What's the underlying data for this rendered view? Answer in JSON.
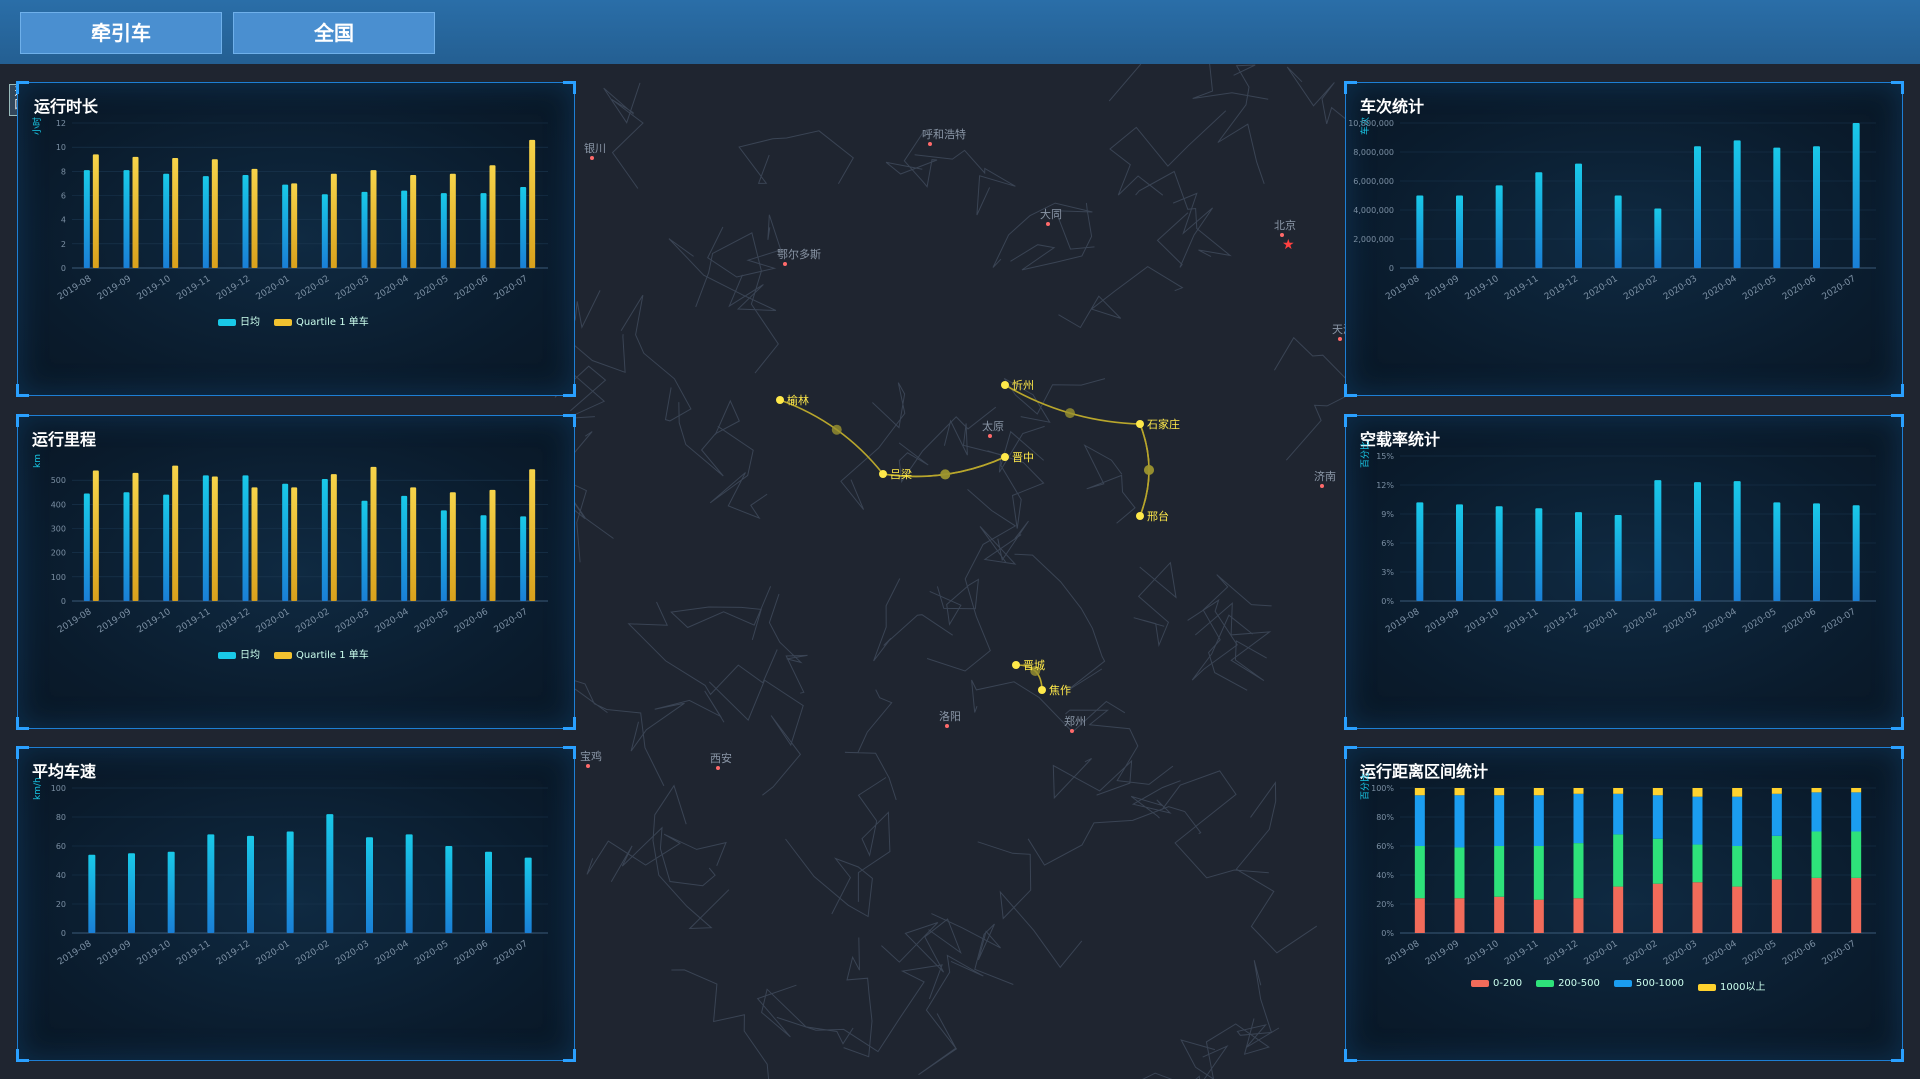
{
  "topbar": {
    "btn_vehicle": "牵引车",
    "btn_region": "全国"
  },
  "back_label": "返回",
  "map": {
    "cities": [
      {
        "name": "榆林",
        "x": 780,
        "y": 400
      },
      {
        "name": "吕梁",
        "x": 883,
        "y": 474
      },
      {
        "name": "晋中",
        "x": 1005,
        "y": 457
      },
      {
        "name": "忻州",
        "x": 1005,
        "y": 385
      },
      {
        "name": "石家庄",
        "x": 1140,
        "y": 424
      },
      {
        "name": "邢台",
        "x": 1140,
        "y": 516
      },
      {
        "name": "晋城",
        "x": 1016,
        "y": 665
      },
      {
        "name": "焦作",
        "x": 1042,
        "y": 690
      }
    ],
    "routes": [
      [
        "榆林",
        "吕梁"
      ],
      [
        "吕梁",
        "晋中"
      ],
      [
        "晋中",
        "吕梁"
      ],
      [
        "忻州",
        "石家庄"
      ],
      [
        "石家庄",
        "邢台"
      ],
      [
        "邢台",
        "石家庄"
      ],
      [
        "晋城",
        "焦作"
      ]
    ],
    "labels": [
      {
        "t": "北京",
        "x": 1282,
        "y": 229
      },
      {
        "t": "太原",
        "x": 990,
        "y": 430
      },
      {
        "t": "西安",
        "x": 718,
        "y": 762
      },
      {
        "t": "郑州",
        "x": 1072,
        "y": 725
      },
      {
        "t": "呼和浩特",
        "x": 930,
        "y": 138
      },
      {
        "t": "鄂尔多斯",
        "x": 785,
        "y": 258
      },
      {
        "t": "银川",
        "x": 592,
        "y": 152
      },
      {
        "t": "大同",
        "x": 1048,
        "y": 218
      },
      {
        "t": "天津",
        "x": 1340,
        "y": 333
      },
      {
        "t": "济南",
        "x": 1322,
        "y": 480
      },
      {
        "t": "洛阳",
        "x": 947,
        "y": 720
      },
      {
        "t": "宝鸡",
        "x": 588,
        "y": 760
      }
    ]
  },
  "colors": {
    "teal": "#19c9e8",
    "blue": "#1a7fd6",
    "yellow": "#f2c230",
    "red": "#f26b5a",
    "green": "#2ee27a",
    "cyan_blue": "#1b9df0",
    "gold": "#ffd22e"
  },
  "panels": {
    "run_time": {
      "title": "运行时长",
      "yunit": "小时",
      "legend": [
        "日均",
        "Quartile 1 单车"
      ]
    },
    "run_mileage": {
      "title": "运行里程",
      "yunit": "km",
      "legend": [
        "日均",
        "Quartile 1 单车"
      ]
    },
    "avg_speed": {
      "title": "平均车速",
      "yunit": "km/h"
    },
    "trip_count": {
      "title": "车次统计",
      "yunit": "车次"
    },
    "empty_rate": {
      "title": "空载率统计",
      "yunit": "百分比"
    },
    "distance_range": {
      "title": "运行距离区间统计",
      "yunit": "百分比",
      "legend": [
        "0-200",
        "200-500",
        "500-1000",
        "1000以上"
      ]
    }
  },
  "chart_data": [
    {
      "id": "run_time",
      "type": "bar",
      "title": "运行时长",
      "ylabel": "小时",
      "categories": [
        "2019-08",
        "2019-09",
        "2019-10",
        "2019-11",
        "2019-12",
        "2020-01",
        "2020-02",
        "2020-03",
        "2020-04",
        "2020-05",
        "2020-06",
        "2020-07"
      ],
      "ylim": [
        0,
        12
      ],
      "yticks": [
        0,
        2,
        4,
        6,
        8,
        10,
        12
      ],
      "series": [
        {
          "name": "日均",
          "values": [
            8.1,
            8.1,
            7.8,
            7.6,
            7.7,
            6.9,
            6.1,
            6.3,
            6.4,
            6.2,
            6.2,
            6.7
          ]
        },
        {
          "name": "Quartile 1 单车",
          "values": [
            9.4,
            9.2,
            9.1,
            9.0,
            8.2,
            7.0,
            7.8,
            8.1,
            7.7,
            7.8,
            8.5,
            10.6
          ]
        }
      ],
      "legend": "bottom"
    },
    {
      "id": "run_mileage",
      "type": "bar",
      "title": "运行里程",
      "ylabel": "km",
      "categories": [
        "2019-08",
        "2019-09",
        "2019-10",
        "2019-11",
        "2019-12",
        "2020-01",
        "2020-02",
        "2020-03",
        "2020-04",
        "2020-05",
        "2020-06",
        "2020-07"
      ],
      "ylim": [
        0,
        600
      ],
      "yticks": [
        0,
        100,
        200,
        300,
        400,
        500
      ],
      "series": [
        {
          "name": "日均",
          "values": [
            445,
            450,
            440,
            520,
            520,
            485,
            505,
            415,
            435,
            375,
            355,
            350
          ]
        },
        {
          "name": "Quartile 1 单车",
          "values": [
            540,
            530,
            560,
            515,
            470,
            470,
            525,
            555,
            470,
            450,
            460,
            545
          ]
        }
      ],
      "legend": "bottom"
    },
    {
      "id": "avg_speed",
      "type": "bar",
      "title": "平均车速",
      "ylabel": "km/h",
      "categories": [
        "2019-08",
        "2019-09",
        "2019-10",
        "2019-11",
        "2019-12",
        "2020-01",
        "2020-02",
        "2020-03",
        "2020-04",
        "2020-05",
        "2020-06",
        "2020-07"
      ],
      "ylim": [
        0,
        100
      ],
      "yticks": [
        0,
        20,
        40,
        60,
        80,
        100
      ],
      "series": [
        {
          "name": "",
          "values": [
            54,
            55,
            56,
            68,
            67,
            70,
            82,
            66,
            68,
            60,
            56,
            52
          ]
        }
      ]
    },
    {
      "id": "trip_count",
      "type": "bar",
      "title": "车次统计",
      "ylabel": "车次",
      "categories": [
        "2019-08",
        "2019-09",
        "2019-10",
        "2019-11",
        "2019-12",
        "2020-01",
        "2020-02",
        "2020-03",
        "2020-04",
        "2020-05",
        "2020-06",
        "2020-07"
      ],
      "ylim": [
        0,
        10000000
      ],
      "yticks": [
        0,
        2000000,
        4000000,
        6000000,
        8000000,
        10000000
      ],
      "ytick_labels": [
        "0",
        "2,000,000",
        "4,000,000",
        "6,000,000",
        "8,000,000",
        "10,000,000"
      ],
      "series": [
        {
          "name": "",
          "values": [
            5000000,
            5000000,
            5700000,
            6600000,
            7200000,
            5000000,
            4100000,
            8400000,
            8800000,
            8300000,
            8400000,
            10000000
          ]
        }
      ]
    },
    {
      "id": "empty_rate",
      "type": "bar",
      "title": "空载率统计",
      "ylabel": "百分比",
      "categories": [
        "2019-08",
        "2019-09",
        "2019-10",
        "2019-11",
        "2019-12",
        "2020-01",
        "2020-02",
        "2020-03",
        "2020-04",
        "2020-05",
        "2020-06",
        "2020-07"
      ],
      "ylim": [
        0,
        15
      ],
      "yticks": [
        0,
        3,
        6,
        9,
        12,
        15
      ],
      "ytick_labels": [
        "0%",
        "3%",
        "6%",
        "9%",
        "12%",
        "15%"
      ],
      "series": [
        {
          "name": "",
          "values": [
            10.2,
            10.0,
            9.8,
            9.6,
            9.2,
            8.9,
            12.5,
            12.3,
            12.4,
            10.2,
            10.1,
            9.9
          ]
        }
      ]
    },
    {
      "id": "distance_range",
      "type": "bar",
      "stacked": true,
      "title": "运行距离区间统计",
      "ylabel": "百分比",
      "categories": [
        "2019-08",
        "2019-09",
        "2019-10",
        "2019-11",
        "2019-12",
        "2020-01",
        "2020-02",
        "2020-03",
        "2020-04",
        "2020-05",
        "2020-06",
        "2020-07"
      ],
      "ylim": [
        0,
        100
      ],
      "yticks": [
        0,
        20,
        40,
        60,
        80,
        100
      ],
      "ytick_labels": [
        "0%",
        "20%",
        "40%",
        "60%",
        "80%",
        "100%"
      ],
      "series": [
        {
          "name": "0-200",
          "values": [
            24,
            24,
            25,
            23,
            24,
            32,
            34,
            35,
            32,
            37,
            38,
            38
          ]
        },
        {
          "name": "200-500",
          "values": [
            36,
            35,
            35,
            37,
            38,
            36,
            31,
            26,
            28,
            30,
            32,
            32
          ]
        },
        {
          "name": "500-1000",
          "values": [
            35,
            36,
            35,
            35,
            34,
            28,
            30,
            33,
            34,
            29,
            27,
            27
          ]
        },
        {
          "name": "1000以上",
          "values": [
            5,
            5,
            5,
            5,
            4,
            4,
            5,
            6,
            6,
            4,
            3,
            3
          ]
        }
      ],
      "legend": "bottom"
    }
  ]
}
